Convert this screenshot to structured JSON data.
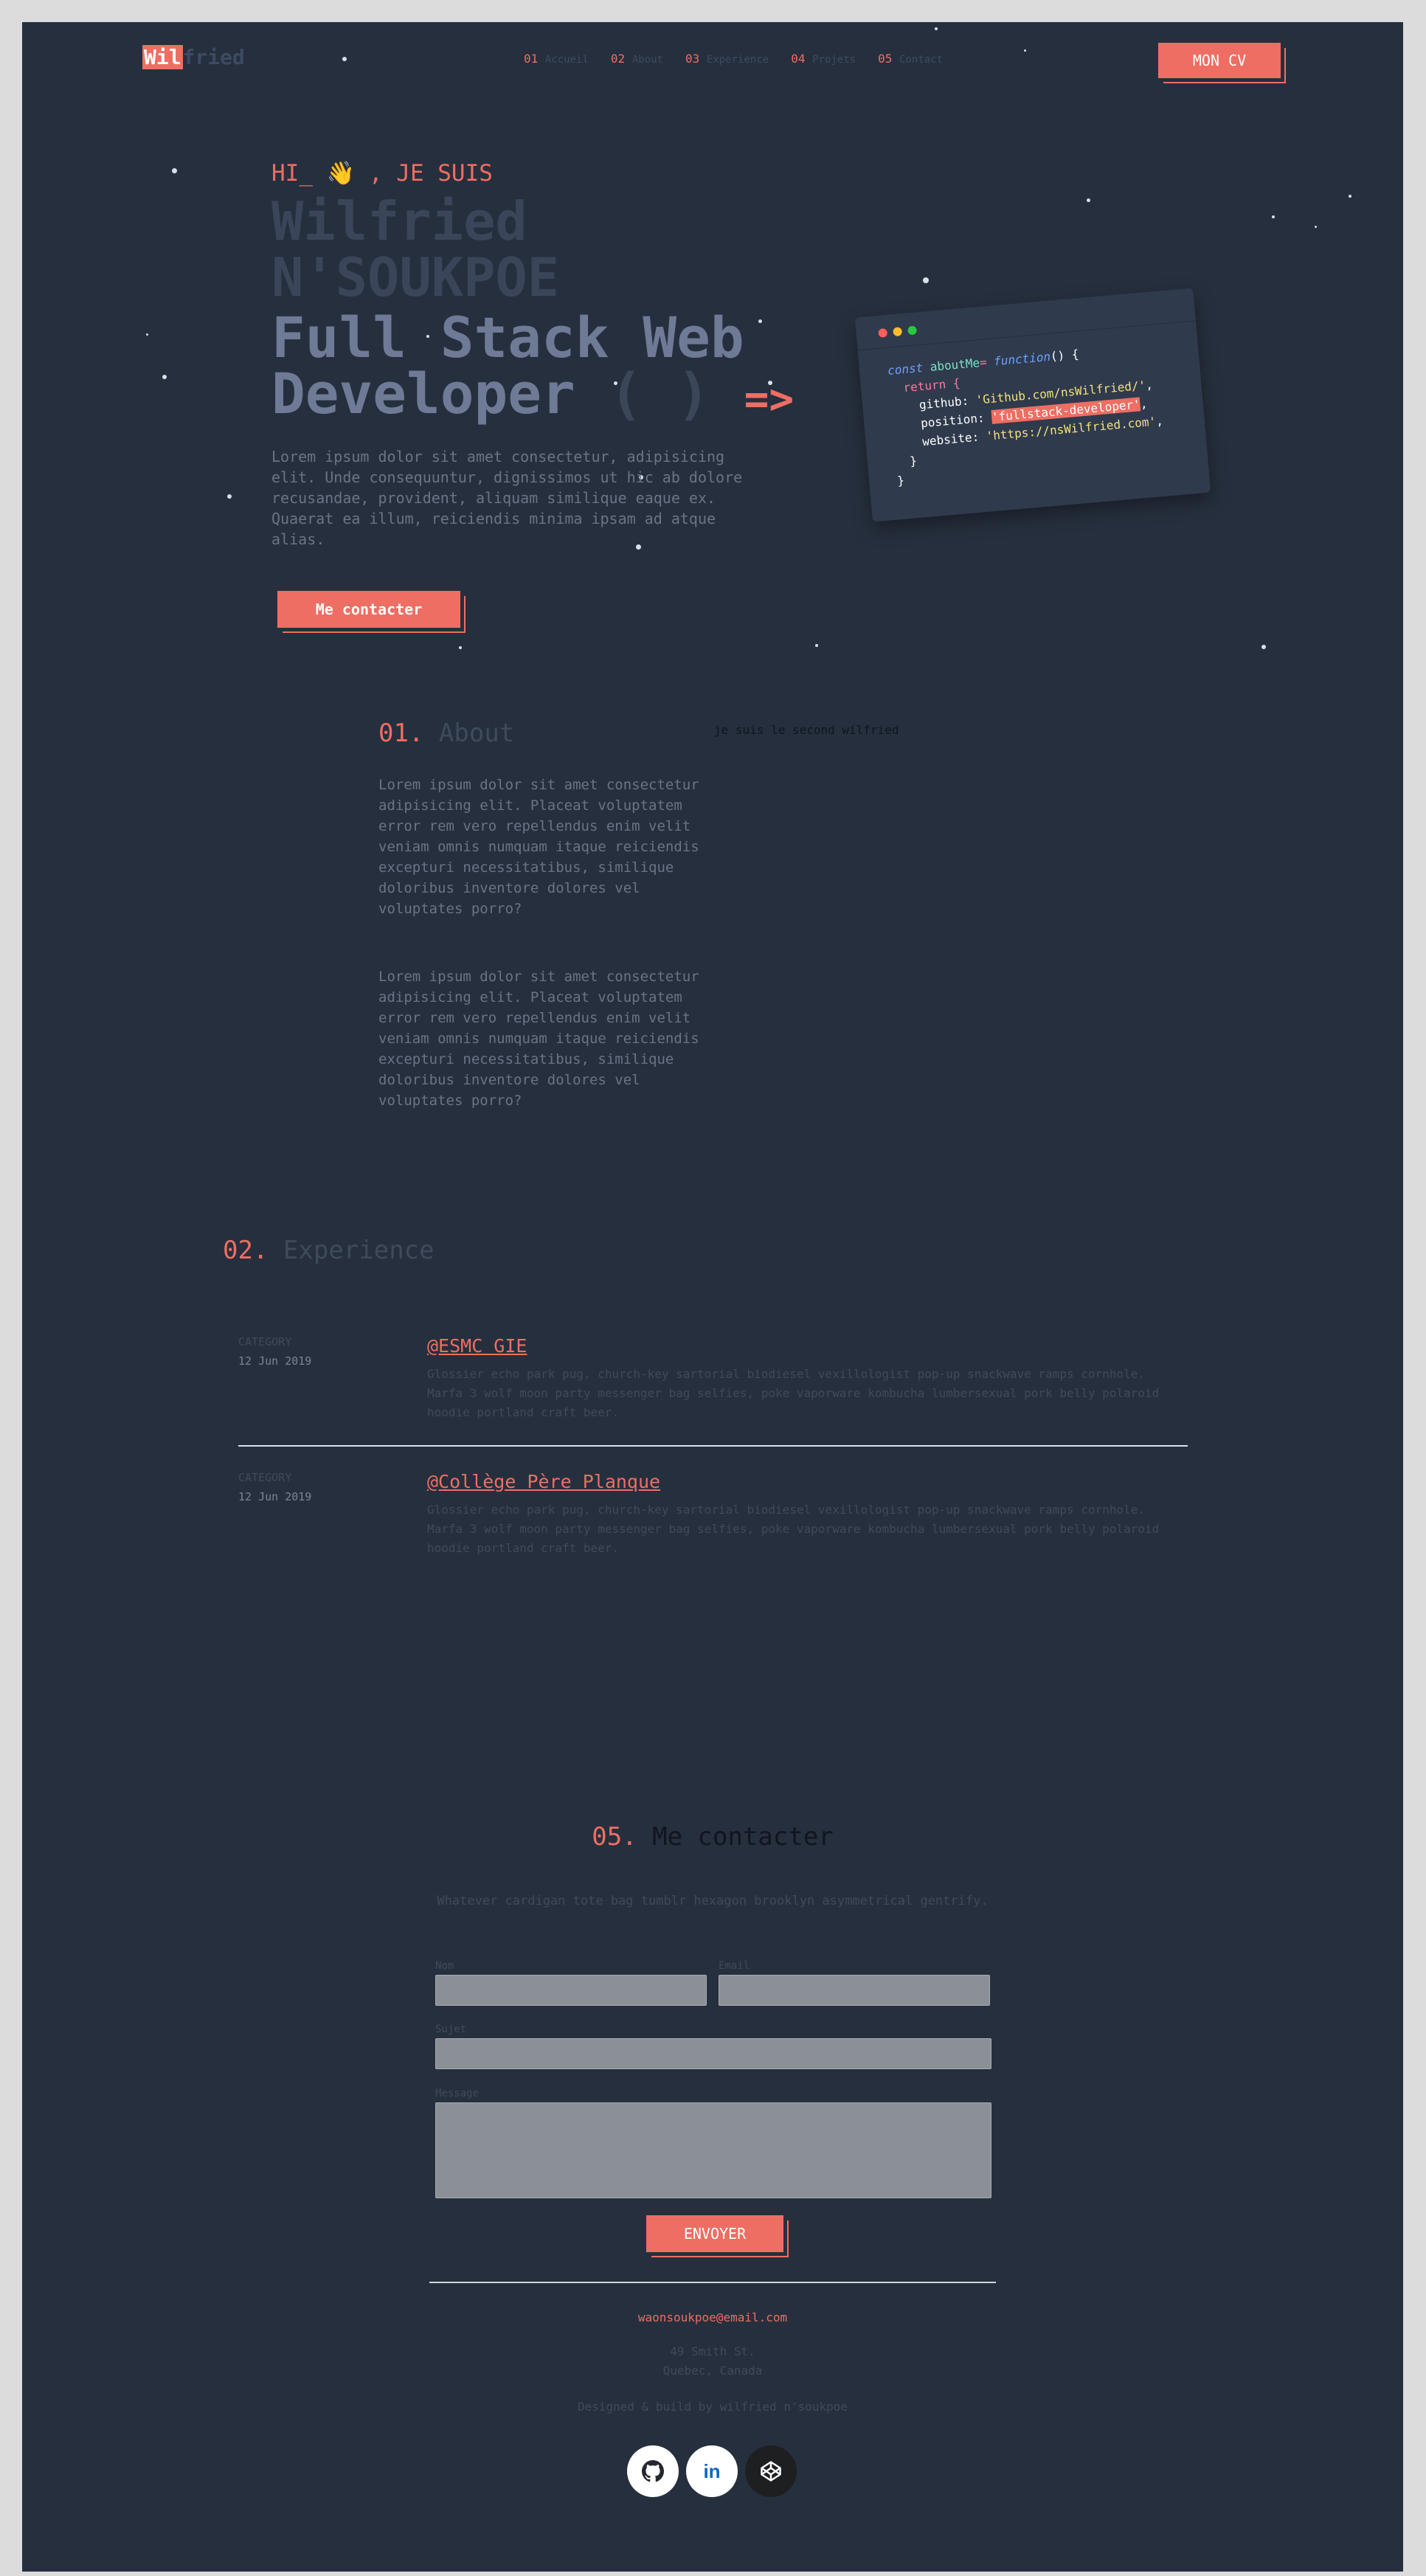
{
  "header": {
    "logo_highlight": "Wil",
    "logo_rest": "fried",
    "nav": [
      {
        "num": "01",
        "label": "Accueil"
      },
      {
        "num": "02",
        "label": "About"
      },
      {
        "num": "03",
        "label": "Experience"
      },
      {
        "num": "04",
        "label": "Projets"
      },
      {
        "num": "05",
        "label": "Contact"
      }
    ],
    "cv_button": "MON CV"
  },
  "hero": {
    "greeting": "HI_",
    "wave_emoji": "👋",
    "greeting_suffix": ", JE SUIS",
    "name_line1": "Wilfried",
    "name_line2": "N'SOUKPOE",
    "role_line1": "Full Stack Web",
    "role_line2": "Developer",
    "role_parens": "( )",
    "role_arrow": "=>",
    "intro": "Lorem ipsum dolor sit amet consectetur, adipisicing elit. Unde consequuntur, dignissimos ut hic ab dolore recusandae, provident, aliquam similique eaque ex. Quaerat ea illum, reiciendis minima ipsam ad atque alias.",
    "contact_button": "Me contacter"
  },
  "code_card": {
    "line1_const": "const",
    "line1_name": "aboutMe",
    "line1_eq": "=",
    "line1_fn": "function",
    "line1_end": "() {",
    "line2": "return {",
    "github_key": "github:",
    "github_val": "'Github.com/nsWilfried/'",
    "position_key": "position:",
    "position_val": "'fullstack-developer'",
    "website_key": "website:",
    "website_val": "'https://nsWilfried.com'",
    "close1": "}",
    "close2": "}",
    "dot_colors": [
      "#ff5f57",
      "#febc2e",
      "#28c840"
    ]
  },
  "about": {
    "num": "01.",
    "title": "About",
    "side_text": "je suis le second wilfried",
    "paragraph1": "Lorem ipsum dolor sit amet consectetur adipisicing elit. Placeat voluptatem error rem vero repellendus enim velit veniam omnis numquam itaque reiciendis excepturi necessitatibus, similique doloribus inventore dolores vel voluptates porro?",
    "paragraph2": "Lorem ipsum dolor sit amet consectetur adipisicing elit. Placeat voluptatem error rem vero repellendus enim velit veniam omnis numquam itaque reiciendis excepturi necessitatibus, similique doloribus inventore dolores vel voluptates porro?"
  },
  "experience": {
    "num": "02.",
    "title": "Experience",
    "jobs": [
      {
        "category": "CATEGORY",
        "date": "12 Jun 2019",
        "company": "@ESMC GIE",
        "description": "Glossier echo park pug, church-key sartorial biodiesel vexillologist pop-up snackwave ramps cornhole. Marfa 3 wolf moon party messenger bag selfies, poke vaporware kombucha lumbersexual pork belly polaroid hoodie portland craft beer."
      },
      {
        "category": "CATEGORY",
        "date": "12 Jun 2019",
        "company": "@Collège Père Planque",
        "description": "Glossier echo park pug, church-key sartorial biodiesel vexillologist pop-up snackwave ramps cornhole. Marfa 3 wolf moon party messenger bag selfies, poke vaporware kombucha lumbersexual pork belly polaroid hoodie portland craft beer."
      }
    ]
  },
  "contact": {
    "num": "05.",
    "title": "Me contacter",
    "subtitle": "Whatever cardigan tote bag tumblr hexagon brooklyn asymmetrical gentrify.",
    "name_label": "Nom",
    "email_label": "Email",
    "subject_label": "Sujet",
    "message_label": "Message",
    "send_button": "ENVOYER"
  },
  "footer": {
    "email": "waonsoukpoe@email.com",
    "address_line1": "49 Smith St.",
    "address_line2": "Quebec, Canada",
    "credit": "Designed & build by wilfried n'soukpoe",
    "socials": [
      "github-icon",
      "linkedin-icon",
      "codepen-icon"
    ]
  },
  "colors": {
    "background": "#262f3d",
    "accent": "#ee6e63",
    "frame": "#dcdcdc"
  }
}
